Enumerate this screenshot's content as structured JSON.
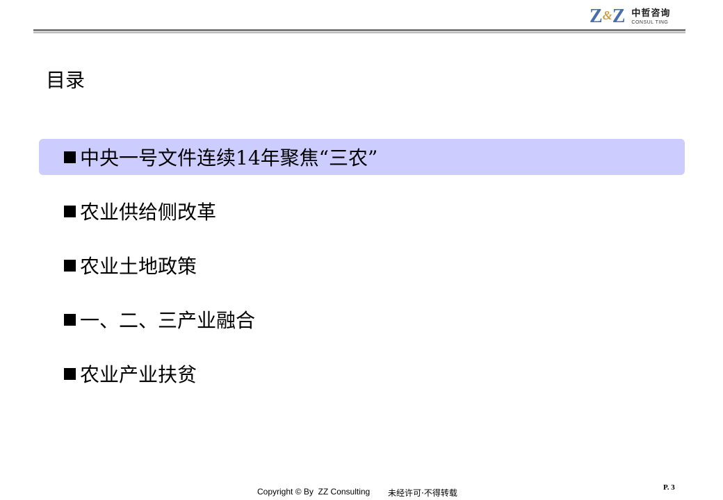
{
  "logo": {
    "mark_left": "Z",
    "mark_amp": "&",
    "mark_right": "Z",
    "name_cn": "中哲咨询",
    "name_en": "CONSUL TING"
  },
  "slide": {
    "title": "目录",
    "toc": [
      {
        "label": "中央一号文件连续14年聚焦“三农”",
        "active": true
      },
      {
        "label": "农业供给侧改革",
        "active": false
      },
      {
        "label": "农业土地政策",
        "active": false
      },
      {
        "label": "一、二、三产业融合",
        "active": false
      },
      {
        "label": "农业产业扶贫",
        "active": false
      }
    ],
    "highlight_color": "#ccccff"
  },
  "footer": {
    "copyright": "Copyright © By  ZZ Consulting",
    "note": "未经许可·不得转载",
    "page": "P. 3"
  }
}
